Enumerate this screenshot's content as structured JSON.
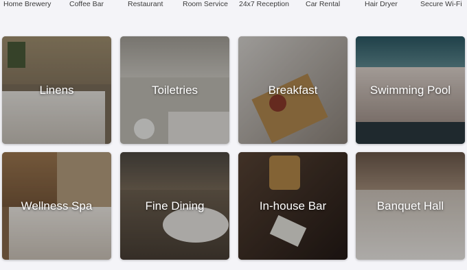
{
  "amenities": [
    "Home Brewery",
    "Coffee Bar",
    "Restaurant",
    "Room Service",
    "24x7 Reception",
    "Car Rental",
    "Hair Dryer",
    "Secure Wi-Fi"
  ],
  "tiles": [
    {
      "label": "Linens",
      "base": "#8b7a63"
    },
    {
      "label": "Toiletries",
      "base": "#b7b4ad"
    },
    {
      "label": "Breakfast",
      "base": "#8f8276"
    },
    {
      "label": "Swimming Pool",
      "base": "#4d6b75"
    },
    {
      "label": "Wellness Spa",
      "base": "#8e6b4e"
    },
    {
      "label": "Fine Dining",
      "base": "#6a5b4c"
    },
    {
      "label": "In-house Bar",
      "base": "#3e2f28"
    },
    {
      "label": "Banquet Hall",
      "base": "#a89482"
    }
  ]
}
